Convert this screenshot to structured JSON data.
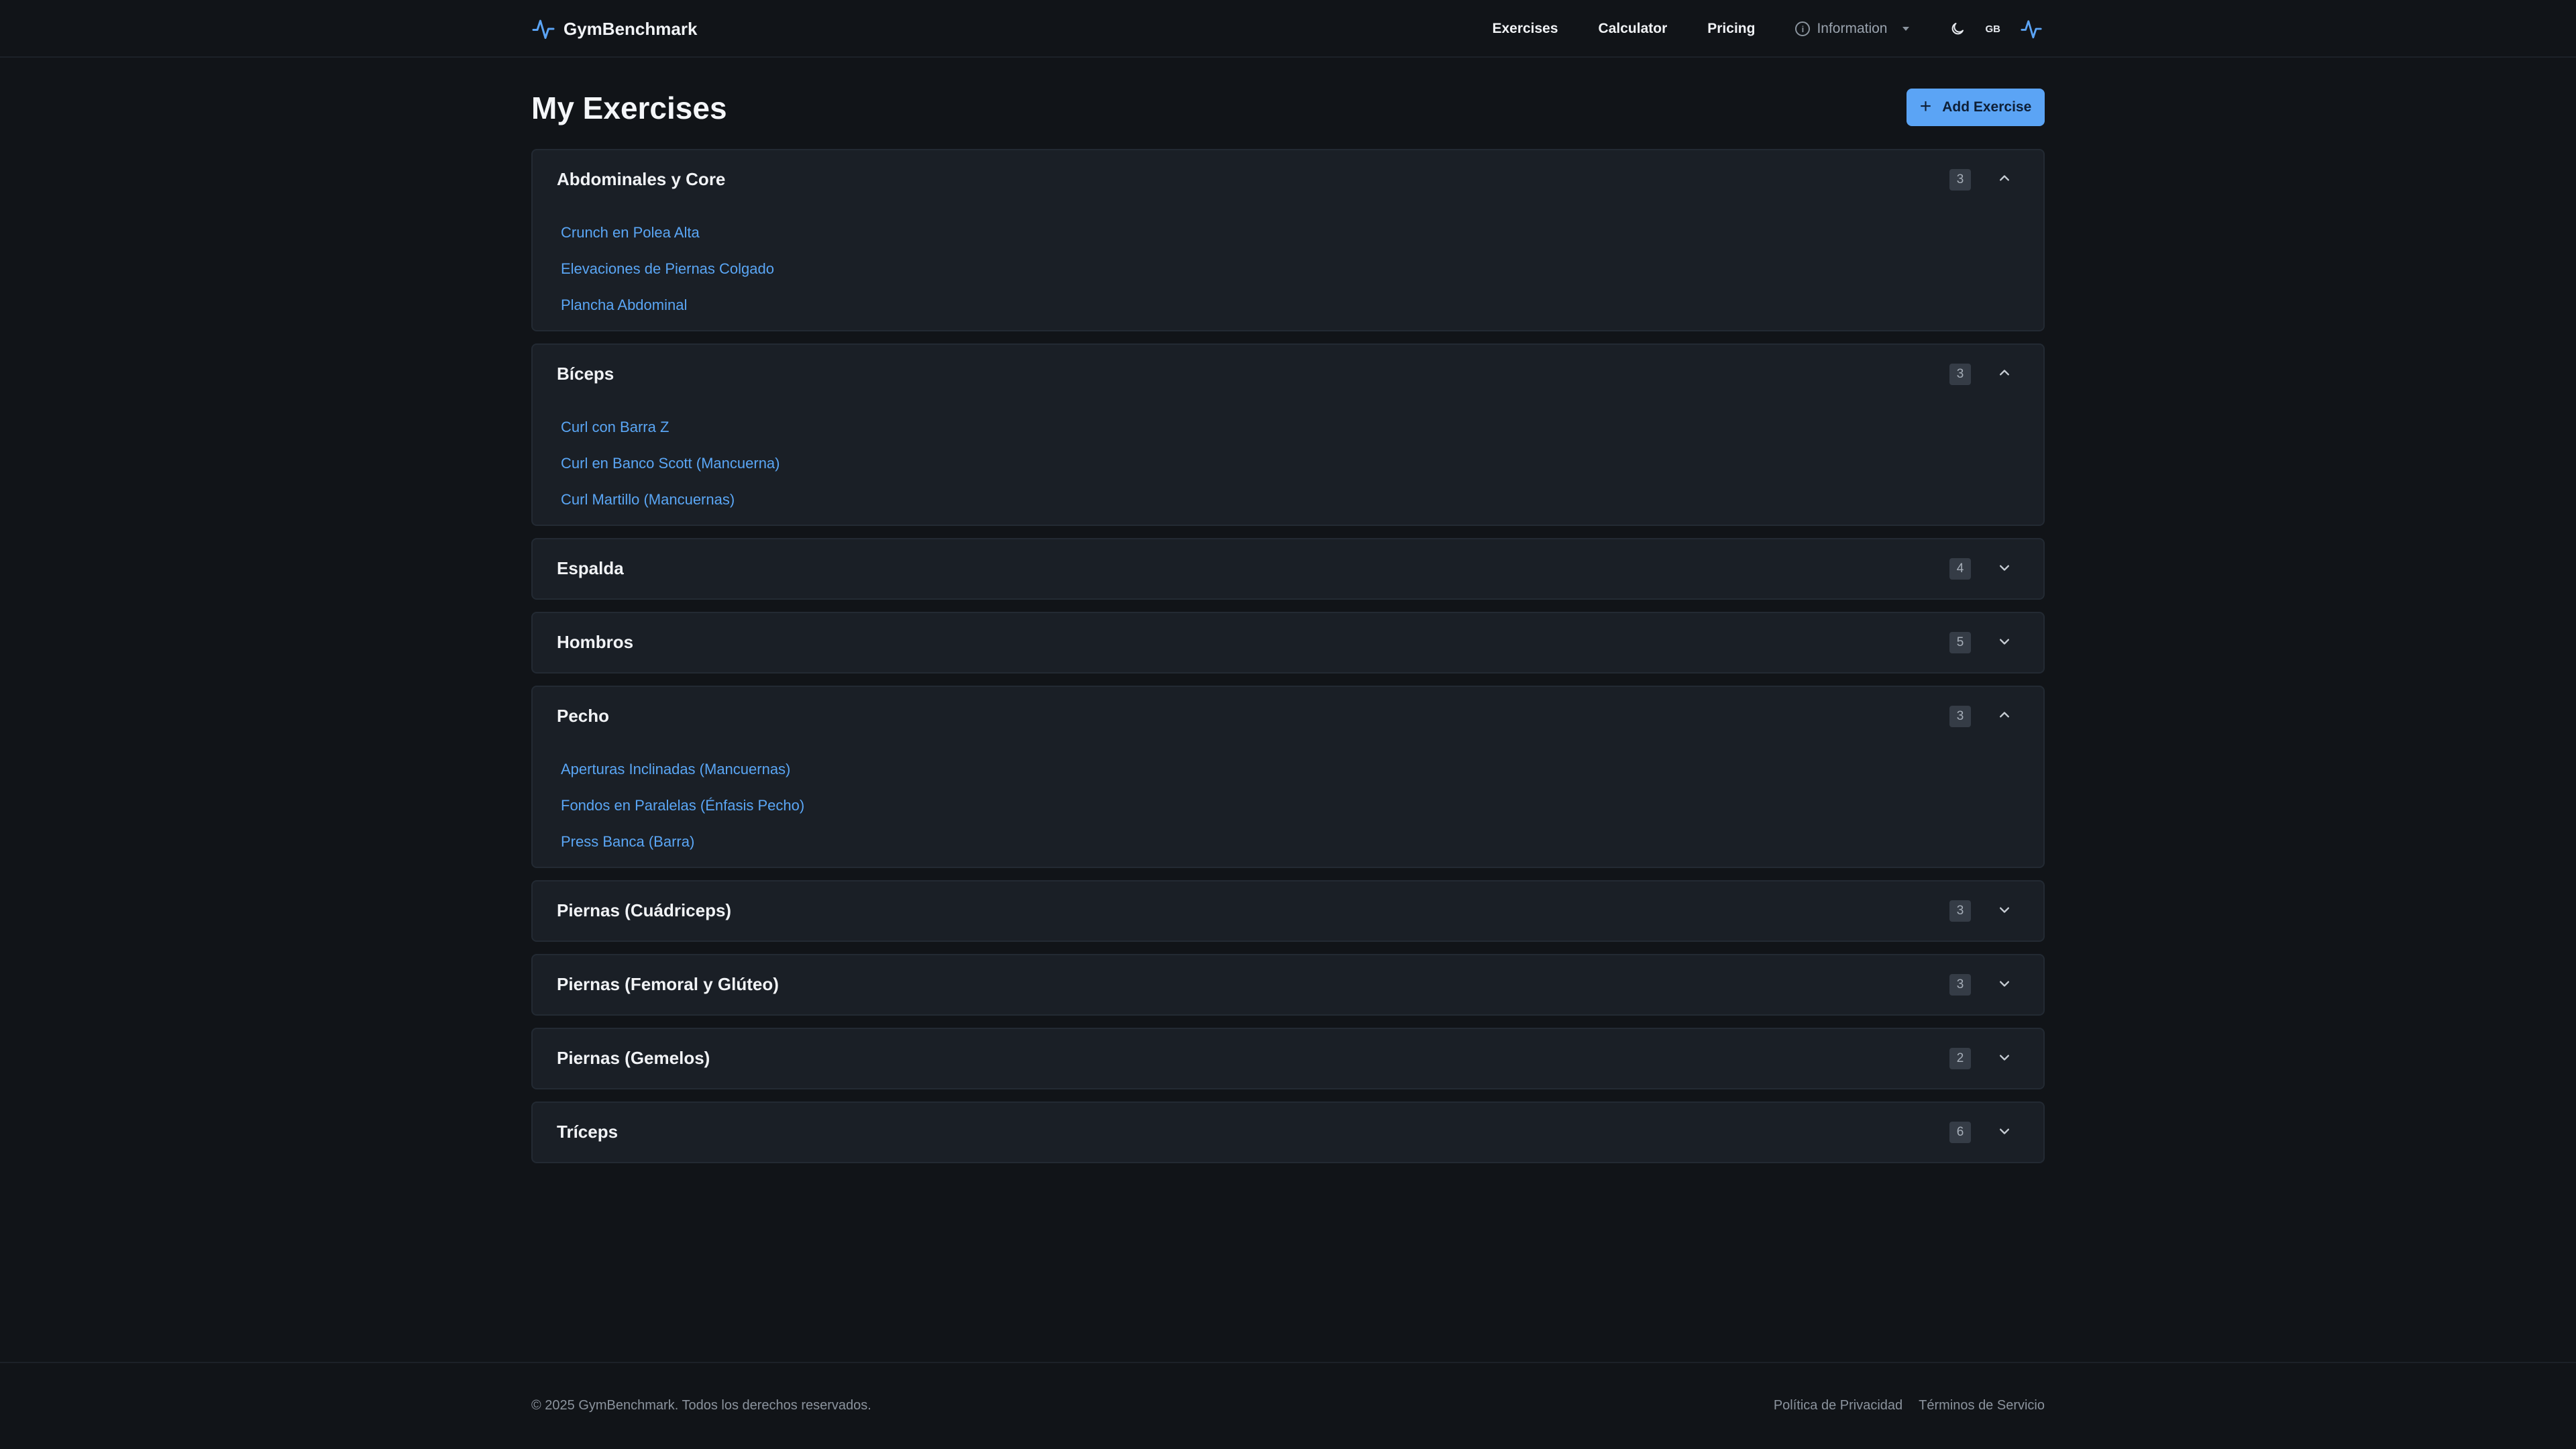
{
  "header": {
    "brand": "GymBenchmark",
    "nav": {
      "exercises": "Exercises",
      "calculator": "Calculator",
      "pricing": "Pricing",
      "information": "Information"
    },
    "language": "GB"
  },
  "main": {
    "title": "My Exercises",
    "add_button": "Add Exercise",
    "groups": [
      {
        "name": "Abdominales y Core",
        "count": "3",
        "expanded": true,
        "items": [
          "Crunch en Polea Alta",
          "Elevaciones de Piernas Colgado",
          "Plancha Abdominal"
        ]
      },
      {
        "name": "Bíceps",
        "count": "3",
        "expanded": true,
        "items": [
          "Curl con Barra Z",
          "Curl en Banco Scott (Mancuerna)",
          "Curl Martillo (Mancuernas)"
        ]
      },
      {
        "name": "Espalda",
        "count": "4",
        "expanded": false,
        "items": []
      },
      {
        "name": "Hombros",
        "count": "5",
        "expanded": false,
        "items": []
      },
      {
        "name": "Pecho",
        "count": "3",
        "expanded": true,
        "items": [
          "Aperturas Inclinadas (Mancuernas)",
          "Fondos en Paralelas (Énfasis Pecho)",
          "Press Banca (Barra)"
        ]
      },
      {
        "name": "Piernas (Cuádriceps)",
        "count": "3",
        "expanded": false,
        "items": []
      },
      {
        "name": "Piernas (Femoral y Glúteo)",
        "count": "3",
        "expanded": false,
        "items": []
      },
      {
        "name": "Piernas (Gemelos)",
        "count": "2",
        "expanded": false,
        "items": []
      },
      {
        "name": "Tríceps",
        "count": "6",
        "expanded": false,
        "items": []
      }
    ]
  },
  "footer": {
    "copyright": "© 2025 GymBenchmark. Todos los derechos reservados.",
    "privacy": "Política de Privacidad",
    "terms": "Términos de Servicio"
  },
  "colors": {
    "accent": "#5ba4f5",
    "link": "#5aa6f5",
    "background": "#111418",
    "card": "#1a1f26"
  }
}
